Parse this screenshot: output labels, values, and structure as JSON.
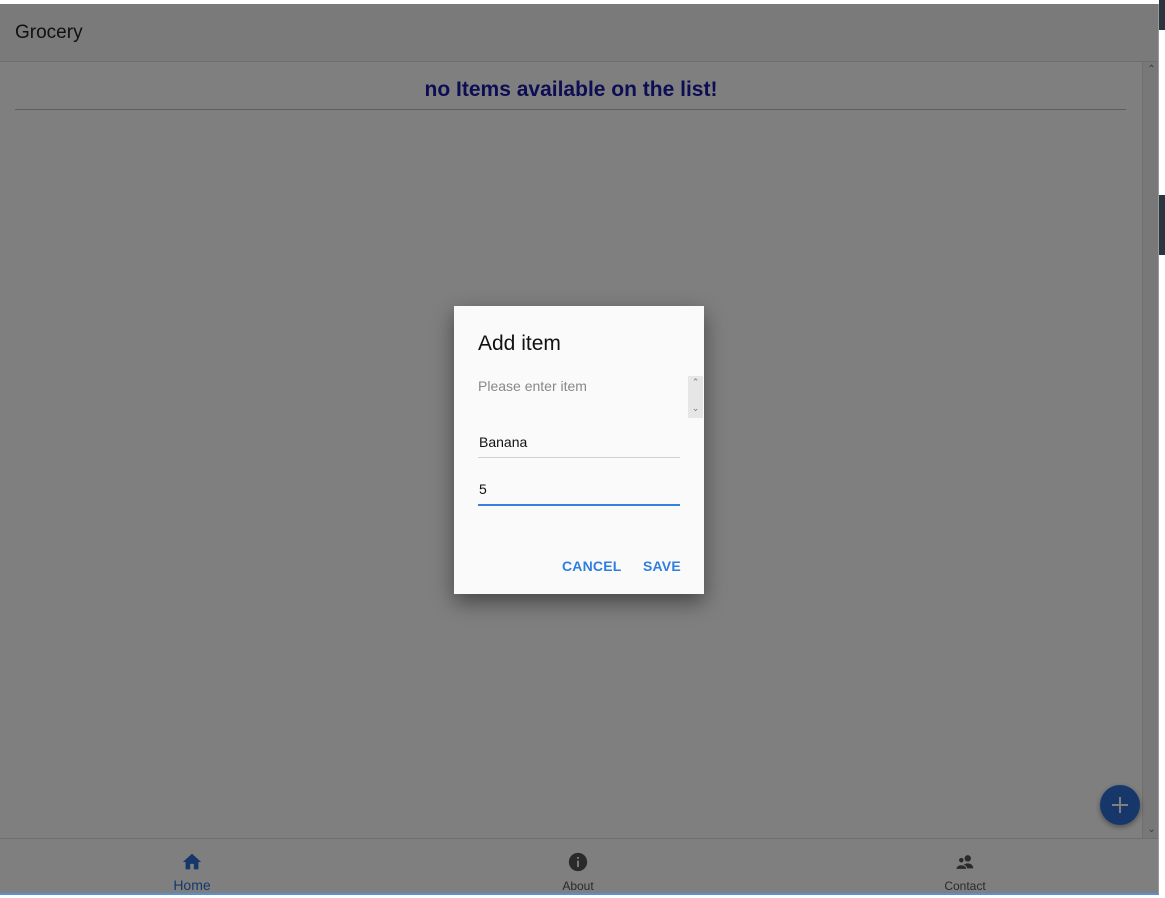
{
  "app": {
    "title": "Grocery"
  },
  "main": {
    "empty_message": "no Items available on the list!"
  },
  "dialog": {
    "title": "Add item",
    "message": "Please enter item",
    "item_name_value": "Banana",
    "quantity_value": "5",
    "cancel_label": "CANCEL",
    "save_label": "SAVE"
  },
  "nav": {
    "items": [
      {
        "label": "Home",
        "icon": "home-icon",
        "active": true
      },
      {
        "label": "About",
        "icon": "info-icon",
        "active": false
      },
      {
        "label": "Contact",
        "icon": "contacts-icon",
        "active": false
      }
    ]
  },
  "fab": {
    "icon": "plus-icon"
  },
  "colors": {
    "accent": "#2f6fd6",
    "empty_message": "#1a1aa8",
    "overlay": "rgba(0,0,0,0.5)"
  }
}
